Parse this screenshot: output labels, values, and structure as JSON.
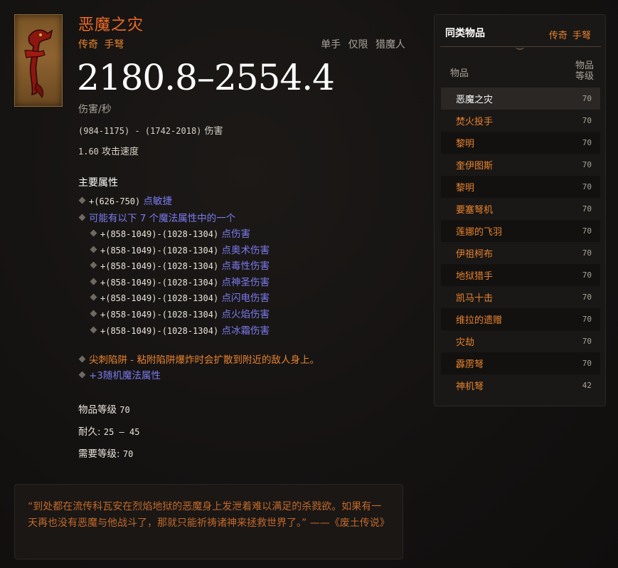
{
  "item": {
    "name": "恶魔之灾",
    "type": "传奇 手弩",
    "tags": [
      "单手",
      "仅限",
      "猎魔人"
    ],
    "dps": "2180.8–2554.4",
    "dps_label": "伤害/秒",
    "damage_range": "(984-1175) - (1742-2018)",
    "damage_label": "伤害",
    "attack_speed": "1.60",
    "attack_speed_label": "攻击速度",
    "icon": "demon-crossbow-icon"
  },
  "primary": {
    "title": "主要属性",
    "affix1_value": "+(626-750)",
    "affix1_label": "点敏捷",
    "magic_header": "可能有以下 7 个魔法属性中的一个",
    "sub_affixes": [
      {
        "value": "+(858-1049)-(1028-1304)",
        "label": "点伤害"
      },
      {
        "value": "+(858-1049)-(1028-1304)",
        "label": "点奥术伤害"
      },
      {
        "value": "+(858-1049)-(1028-1304)",
        "label": "点毒性伤害"
      },
      {
        "value": "+(858-1049)-(1028-1304)",
        "label": "点神圣伤害"
      },
      {
        "value": "+(858-1049)-(1028-1304)",
        "label": "点闪电伤害"
      },
      {
        "value": "+(858-1049)-(1028-1304)",
        "label": "点火焰伤害"
      },
      {
        "value": "+(858-1049)-(1028-1304)",
        "label": "点冰霜伤害"
      }
    ],
    "legendary": "尖刺陷阱 - 粘附陷阱爆炸时会扩散到附近的敌人身上。",
    "random": "+3随机魔法属性"
  },
  "stats": {
    "item_level_label": "物品等级",
    "item_level": "70",
    "durability_label": "耐久:",
    "durability": "25 – 45",
    "required_level_label": "需要等级:",
    "required_level": "70"
  },
  "flavor": "“到处都在流传科瓦安在烈焰地狱的恶魔身上发泄着难以满足的杀戮欲。如果有一天再也没有恶魔与他战斗了，那就只能祈祷诸神来拯救世界了。” ——《废土传说》",
  "sidebar": {
    "title": "同类物品",
    "type": "传奇 手弩",
    "col_item": "物品",
    "col_level_1": "物品",
    "col_level_2": "等级",
    "items": [
      {
        "name": "恶魔之灾",
        "level": "70"
      },
      {
        "name": "焚火投手",
        "level": "70"
      },
      {
        "name": "黎明",
        "level": "70"
      },
      {
        "name": "奎伊图斯",
        "level": "70"
      },
      {
        "name": "黎明",
        "level": "70"
      },
      {
        "name": "要塞弩机",
        "level": "70"
      },
      {
        "name": "莲娜的飞羽",
        "level": "70"
      },
      {
        "name": "伊祖柯布",
        "level": "70"
      },
      {
        "name": "地狱猎手",
        "level": "70"
      },
      {
        "name": "凯马十击",
        "level": "70"
      },
      {
        "name": "维拉的遗赠",
        "level": "70"
      },
      {
        "name": "灾劫",
        "level": "70"
      },
      {
        "name": "霹雳弩",
        "level": "70"
      },
      {
        "name": "神机弩",
        "level": "42"
      }
    ]
  }
}
